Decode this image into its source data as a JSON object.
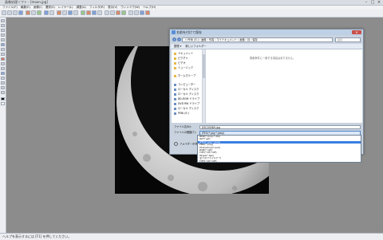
{
  "app": {
    "title": "画像処理ソフト - [moon.jpg]",
    "menus": [
      "ファイル(F)",
      "編集(E)",
      "画像(I)",
      "選択(S)",
      "レイヤー(L)",
      "調整(A)",
      "フィルタ(R)",
      "表示(V)",
      "ウィンドウ(W)",
      "ヘルプ(H)"
    ]
  },
  "dialog": {
    "title": "名前を付けて保存",
    "close_label": "✕",
    "address": "« PENI (E:) › 画像 › 写真 › マイドキュメント › 画像 › 月 › 保存",
    "search_placeholder": "検索",
    "toolbar": [
      "整理 ▾",
      "新しいフォルダー"
    ],
    "nav_items": [
      {
        "label": "ドキュメント",
        "kind": "lib"
      },
      {
        "label": "ピクチャ",
        "kind": "lib"
      },
      {
        "label": "ビデオ",
        "kind": "lib"
      },
      {
        "label": "ミュージック",
        "kind": "lib"
      },
      {
        "label": "ホームグループ",
        "kind": "lib"
      },
      {
        "label": "コンピューター",
        "kind": "pc"
      },
      {
        "label": "ローカル ディスク",
        "kind": "pc"
      },
      {
        "label": "ローカル ディスク",
        "kind": "pc"
      },
      {
        "label": "BD-ROM ドライブ",
        "kind": "pc"
      },
      {
        "label": "DVD RW ドライブ",
        "kind": "pc"
      },
      {
        "label": "ローカル ディスク",
        "kind": "pc"
      },
      {
        "label": "PENI (E:)",
        "kind": "pc"
      }
    ],
    "empty_message": "検索条件に一致する項目はありません。",
    "filename_label": "ファイル名(N):",
    "filename_value": "DSC00089.jpg",
    "filetype_label": "ファイルの種類(T):",
    "filetype_value": "JPEG(*.jpg;*.jpeg)",
    "hide_folders_label": "フォルダーの非表示",
    "filetype_options": [
      "BMP(*.bmp;*.dib)",
      "GIF(*.gif)",
      "JPEG(*.jpg;*.jpeg)",
      "PNG(*.png)",
      "Photoshop(*.psd)",
      "RGB(*.rgb)",
      "TIFF(*.tif;*.tiff)",
      "Targa(*.tga)",
      "全てのファイル(*.*)",
      "TIFF(*.tif;*.tiff)"
    ],
    "selected_option_index": 2
  },
  "status": {
    "text": "ヘルプを表示するには [F1] を押してください。"
  }
}
